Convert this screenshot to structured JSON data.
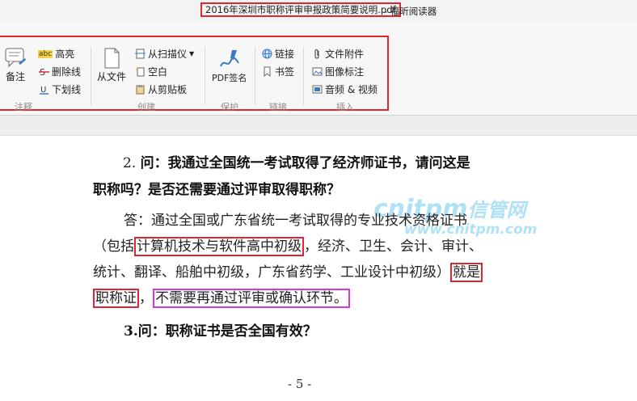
{
  "titlebar": {
    "file_name": "2016年深圳市职称评审申报政策简要说明.pdf",
    "app_suffix": "- 福昕阅读器"
  },
  "ribbon": {
    "groups": {
      "annotate": "注释",
      "create": "创建",
      "protect": "保护",
      "links": "链接",
      "insert": "插入"
    },
    "annotate": {
      "note": "备注",
      "highlight": "高亮",
      "strikeout": "删除线",
      "underline": "下划线",
      "abc": "abc"
    },
    "create": {
      "from_file": "从文件",
      "from_scanner": "从扫描仪",
      "blank": "空白",
      "from_clipboard": "从剪贴板"
    },
    "protect": {
      "pdf_sign": "PDF签名"
    },
    "links": {
      "link": "链接",
      "bookmark": "书签"
    },
    "insert": {
      "file_attachment": "文件附件",
      "image_annotation": "图像标注",
      "audio_video": "音频 & 视频"
    }
  },
  "document": {
    "q2_num": "2.",
    "q2_line1": "问：我通过全国统一考试取得了经济师证书，请问这是",
    "q2_line2": "职称吗？是否还需要通过评审取得职称？",
    "a_line1": "答：通过全国或广东省统一考试取得的专业技术资格证书",
    "a_line2_pre": "（包括",
    "a_line2_box": "计算机技术与软件高中初级",
    "a_line2_post": "，经济、卫生、会计、审计、",
    "a_line3_pre": "统计、翻译、船舶中初级，广东省药学、工业设计中初级）",
    "a_line3_box": "就是",
    "a_line4_box1": "职称证",
    "a_line4_mid": "，",
    "a_line4_box2": "不需要再通过评审或确认环节。",
    "q3": "3.问：职称证书是否全国有效？",
    "page_number": "- 5 -"
  },
  "watermark": {
    "main": "cnitpm",
    "cn": "信管网",
    "url": "www.cnitpm.com"
  },
  "colors": {
    "annotation_red": "#e0262f",
    "annotation_magenta": "#d838d8",
    "watermark": "#6ec8f0"
  }
}
